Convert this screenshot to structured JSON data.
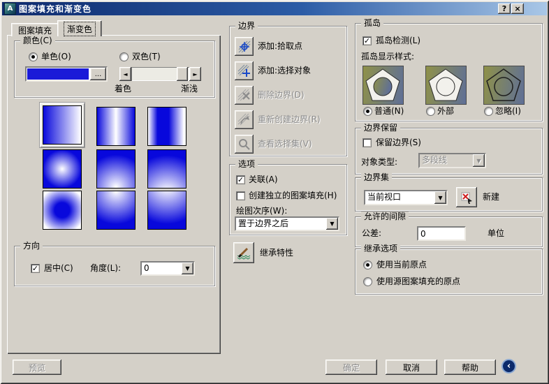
{
  "window": {
    "title": "图案填充和渐变色",
    "help": "?",
    "close": "×"
  },
  "tabs": {
    "hatch": "图案填充",
    "gradient": "渐变色"
  },
  "color_group": {
    "title": "颜色(C)",
    "one_color": "单色(O)",
    "two_color": "双色(T)",
    "swatch_color": "#1a1ad8",
    "browse": "...",
    "shade": "着色",
    "tint": "渐浅"
  },
  "gradient_patterns": {
    "selected": "linear",
    "names": [
      "linear",
      "cylinder",
      "inverted-cylinder",
      "spherical",
      "hemispherical",
      "curved",
      "inverted-spherical",
      "inverted-hemispherical",
      "inverted-curved"
    ]
  },
  "direction_group": {
    "title": "方向",
    "centered": "居中(C)",
    "angle_label": "角度(L):",
    "angle_value": "0"
  },
  "boundary_group": {
    "title": "边界",
    "buttons": [
      {
        "label": "添加:拾取点",
        "enabled": true
      },
      {
        "label": "添加:选择对象",
        "enabled": true
      },
      {
        "label": "删除边界(D)",
        "enabled": false
      },
      {
        "label": "重新创建边界(R)",
        "enabled": false
      },
      {
        "label": "查看选择集(V)",
        "enabled": false
      }
    ]
  },
  "options_group": {
    "title": "选项",
    "associative": "关联(A)",
    "independent": "创建独立的图案填充(H)",
    "draw_order_label": "绘图次序(W):",
    "draw_order_value": "置于边界之后"
  },
  "inherit_properties": "继承特性",
  "islands_group": {
    "title": "孤岛",
    "detection": "孤岛检测(L)",
    "style_label": "孤岛显示样式:",
    "styles": [
      {
        "label": "普通(N)",
        "selected": true
      },
      {
        "label": "外部",
        "selected": false
      },
      {
        "label": "忽略(I)",
        "selected": false
      }
    ]
  },
  "retention_group": {
    "title": "边界保留",
    "retain": "保留边界(S)",
    "object_type_label": "对象类型:",
    "object_type_value": "多段线"
  },
  "boundary_set_group": {
    "title": "边界集",
    "value": "当前视口",
    "new_label": "新建"
  },
  "gap_group": {
    "title": "允许的间隙",
    "tolerance_label": "公差:",
    "tolerance_value": "0",
    "units": "单位"
  },
  "origin_group": {
    "title": "继承选项",
    "options": [
      {
        "label": "使用当前原点",
        "selected": true
      },
      {
        "label": "使用源图案填充的原点",
        "selected": false
      }
    ]
  },
  "footer": {
    "preview": "预览",
    "ok": "确定",
    "cancel": "取消",
    "help": "帮助",
    "collapse": "‹"
  },
  "glyphs": {
    "dropdown": "▼",
    "arrow_left": "◄",
    "arrow_right": "►",
    "check": "✓",
    "app_initial": "A"
  },
  "colors": {
    "dialog_bg": "#d4d0c8",
    "titlebar_start": "#0e2a6d",
    "titlebar_end": "#a9c7e7",
    "gradient_blue": "#0808dc",
    "swatch_blue": "#1a1ad8",
    "island_olive": "#8f9148",
    "island_slate": "#5f6f97"
  }
}
